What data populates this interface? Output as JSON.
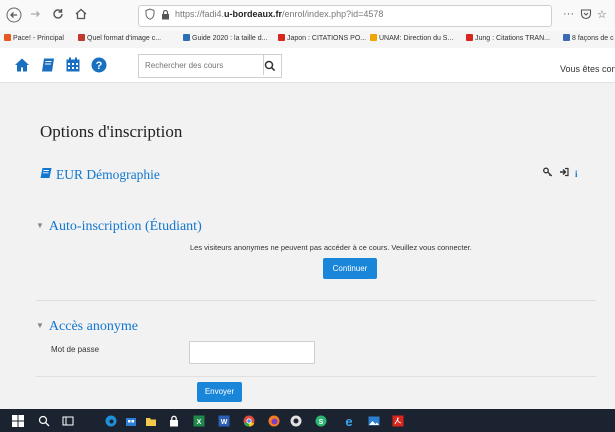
{
  "browser": {
    "url_prefix": "https://fadi4.",
    "url_domain": "u-bordeaux.fr",
    "url_path": "/enrol/index.php?id=4578",
    "bookmarks": [
      {
        "label": "Pace! - Principal",
        "color": "#e8571f"
      },
      {
        "label": "Quel format d'image c...",
        "color": "#c0392b"
      },
      {
        "label": "Guide 2020 : la taille d...",
        "color": "#2c6fb5"
      },
      {
        "label": "Japon : CITATIONS PO...",
        "color": "#d9261c"
      },
      {
        "label": "UNAM: Direction du S...",
        "color": "#f0a500"
      },
      {
        "label": "Jung : Citations TRAN...",
        "color": "#d9261c"
      },
      {
        "label": "8 façons de c",
        "color": "#3b6bb3"
      }
    ]
  },
  "navbar": {
    "search_placeholder": "Rechercher des cours",
    "login_text": "Vous êtes con"
  },
  "page": {
    "title": "Options d'inscription",
    "course_name": "EUR Démographie",
    "self_enrol_heading": "Auto-inscription (Étudiant)",
    "notice": "Les visiteurs anonymes ne peuvent pas accéder à ce cours. Veuillez vous connecter.",
    "continue_label": "Continuer",
    "guest_heading": "Accès anonyme",
    "password_label": "Mot de passe",
    "password_value": "",
    "submit_label": "Envoyer"
  },
  "colors": {
    "link": "#1177d1",
    "button": "#1a86da",
    "navbar_icon": "#1a6fbf",
    "taskbar": "#1b2330"
  }
}
